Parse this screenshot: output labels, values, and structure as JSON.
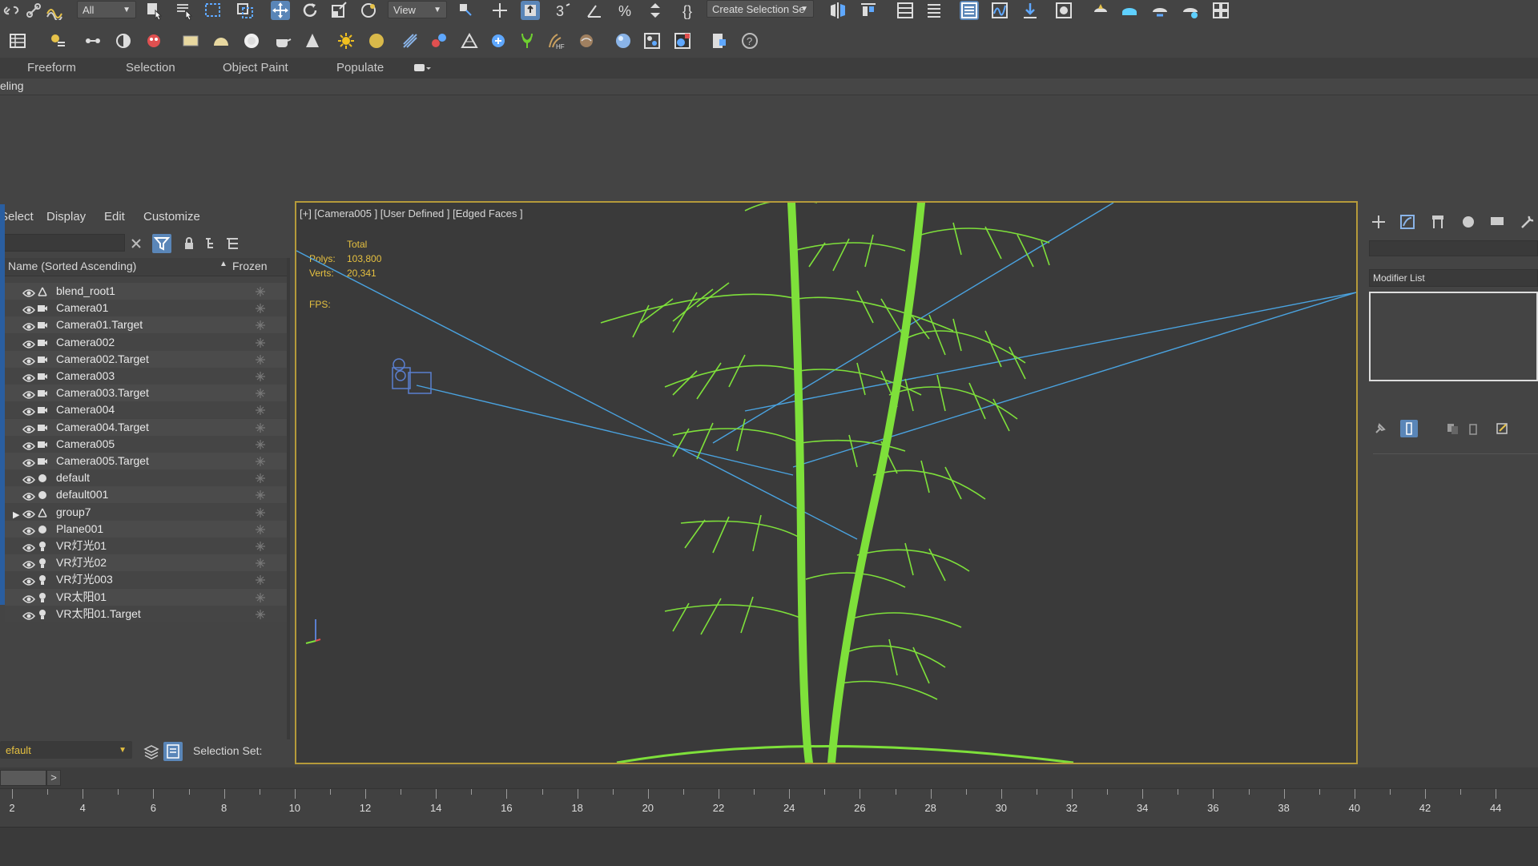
{
  "toolbar": {
    "filter_select": "All",
    "refcoord_select": "View",
    "selection_set_select": "Create Selection Se"
  },
  "ribbon": {
    "tabs": [
      "Freeform",
      "Selection",
      "Object Paint",
      "Populate"
    ],
    "sub_label": "eling"
  },
  "explorer": {
    "menu": [
      "Select",
      "Display",
      "Edit",
      "Customize"
    ],
    "col_name": "Name (Sorted Ascending)",
    "col_frozen": "Frozen",
    "sort_arrow": "▲",
    "rows": [
      {
        "name": "blend_root1",
        "type": "helper"
      },
      {
        "name": "Camera01",
        "type": "camera"
      },
      {
        "name": "Camera01.Target",
        "type": "camera"
      },
      {
        "name": "Camera002",
        "type": "camera"
      },
      {
        "name": "Camera002.Target",
        "type": "camera"
      },
      {
        "name": "Camera003",
        "type": "camera"
      },
      {
        "name": "Camera003.Target",
        "type": "camera"
      },
      {
        "name": "Camera004",
        "type": "camera"
      },
      {
        "name": "Camera004.Target",
        "type": "camera"
      },
      {
        "name": "Camera005",
        "type": "camera"
      },
      {
        "name": "Camera005.Target",
        "type": "camera"
      },
      {
        "name": "default",
        "type": "geometry"
      },
      {
        "name": "default001",
        "type": "geometry"
      },
      {
        "name": "group7",
        "type": "helper",
        "expandable": true
      },
      {
        "name": "Plane001",
        "type": "geometry"
      },
      {
        "name": "VR灯光01",
        "type": "light"
      },
      {
        "name": "VR灯光02",
        "type": "light"
      },
      {
        "name": "VR灯光003",
        "type": "light"
      },
      {
        "name": "VR太阳01",
        "type": "light"
      },
      {
        "name": "VR太阳01.Target",
        "type": "light"
      }
    ],
    "layer_select": "efault",
    "selection_set_label": "Selection Set:"
  },
  "viewport": {
    "label": "[+] [Camera005 ] [User Defined ] [Edged Faces ]",
    "stats": {
      "total_label": "Total",
      "polys_label": "Polys:",
      "polys_value": "103,800",
      "verts_label": "Verts:",
      "verts_value": "20,341",
      "fps_label": "FPS:"
    }
  },
  "command_panel": {
    "modifier_list_label": "Modifier List"
  },
  "timeline": {
    "ticks": [
      "2",
      "4",
      "6",
      "8",
      "10",
      "12",
      "14",
      "16",
      "18",
      "20",
      "22",
      "24",
      "26",
      "28",
      "30",
      "32",
      "34",
      "36",
      "38",
      "40",
      "42",
      "44"
    ],
    "next_button": ">"
  },
  "colors": {
    "accent": "#5a86b8",
    "viewport_border": "#b59a3a",
    "bamboo": "#7ee03a",
    "camera_lines": "#4aa3e0",
    "stats_text": "#e5c040"
  }
}
